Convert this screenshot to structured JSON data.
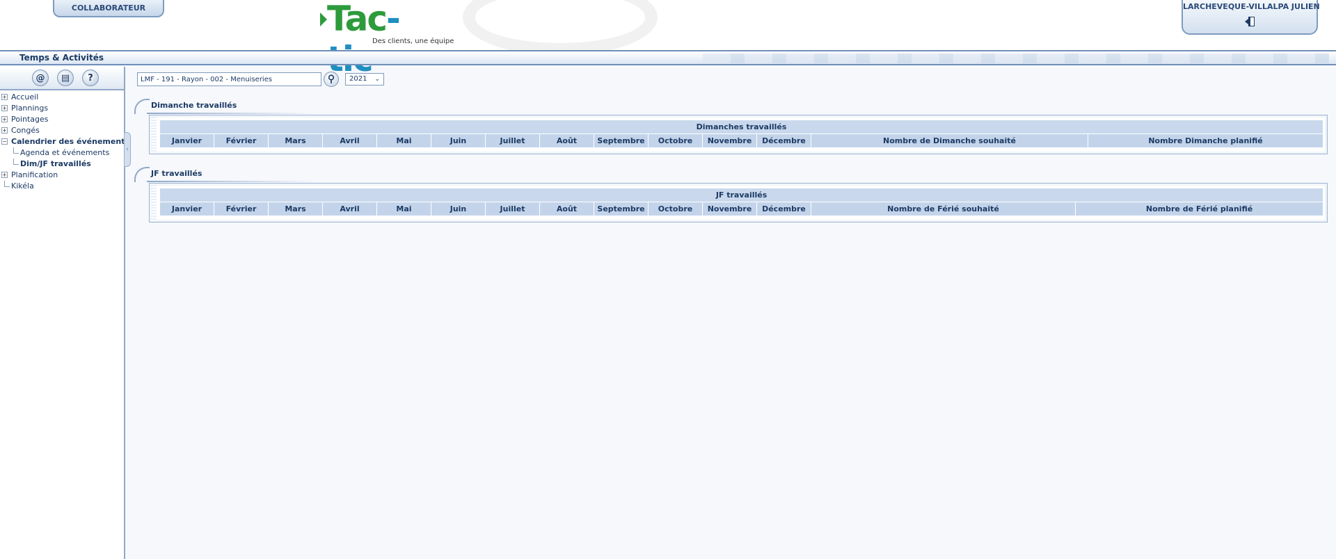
{
  "header": {
    "role_tab": "COLLABORATEUR",
    "logo_title_a": "Tac",
    "logo_title_b": "-tic",
    "logo_subtitle": "Des clients, une équipe",
    "user_name": "LARCHEVEQUE-VILLALPA JULIEN",
    "logout_icon": "door-exit-icon"
  },
  "titlebar": {
    "title": "Temps & Activités"
  },
  "sidebar": {
    "tools": [
      {
        "glyph": "@",
        "icon": "email-icon"
      },
      {
        "glyph": "▤",
        "icon": "notepad-icon"
      },
      {
        "glyph": "?",
        "icon": "help-icon"
      }
    ],
    "tree": [
      {
        "label": "Accueil",
        "expander": "+"
      },
      {
        "label": "Plannings",
        "expander": "+"
      },
      {
        "label": "Pointages",
        "expander": "+"
      },
      {
        "label": "Congés",
        "expander": "+"
      },
      {
        "label": "Calendrier des événements",
        "expander": "−"
      },
      {
        "label": "Agenda et événements"
      },
      {
        "label": "Dim/JF travaillés"
      },
      {
        "label": "Planification",
        "expander": "+"
      },
      {
        "label": "Kikéla"
      }
    ]
  },
  "filters": {
    "site_value": "LMF - 191 - Rayon - 002 - Menuiseries",
    "search_icon": "search-key-icon",
    "year_value": "2021"
  },
  "sections": {
    "dimanche": {
      "tab": "Dimanche travaillés",
      "caption": "Dimanches travaillés",
      "months": [
        "Janvier",
        "Février",
        "Mars",
        "Avril",
        "Mai",
        "Juin",
        "Juillet",
        "Août",
        "Septembre",
        "Octobre",
        "Novembre",
        "Décembre"
      ],
      "col_souhaite": "Nombre de Dimanche souhaité",
      "col_planifie": "Nombre Dimanche planifié"
    },
    "jf": {
      "tab": "JF travaillés",
      "caption": "JF travaillés",
      "months": [
        "Janvier",
        "Février",
        "Mars",
        "Avril",
        "Mai",
        "Juin",
        "Juillet",
        "Août",
        "Septembre",
        "Octobre",
        "Novembre",
        "Décembre"
      ],
      "col_souhaite": "Nombre de Férié souhaité",
      "col_planifie": "Nombre de Férié planifié"
    }
  },
  "colors": {
    "accent": "#1c3a64",
    "header_cell": "#c3d4ea",
    "border": "#8fa8c8",
    "logo_green": "#2d9b3b",
    "logo_blue": "#1f8fbf"
  }
}
